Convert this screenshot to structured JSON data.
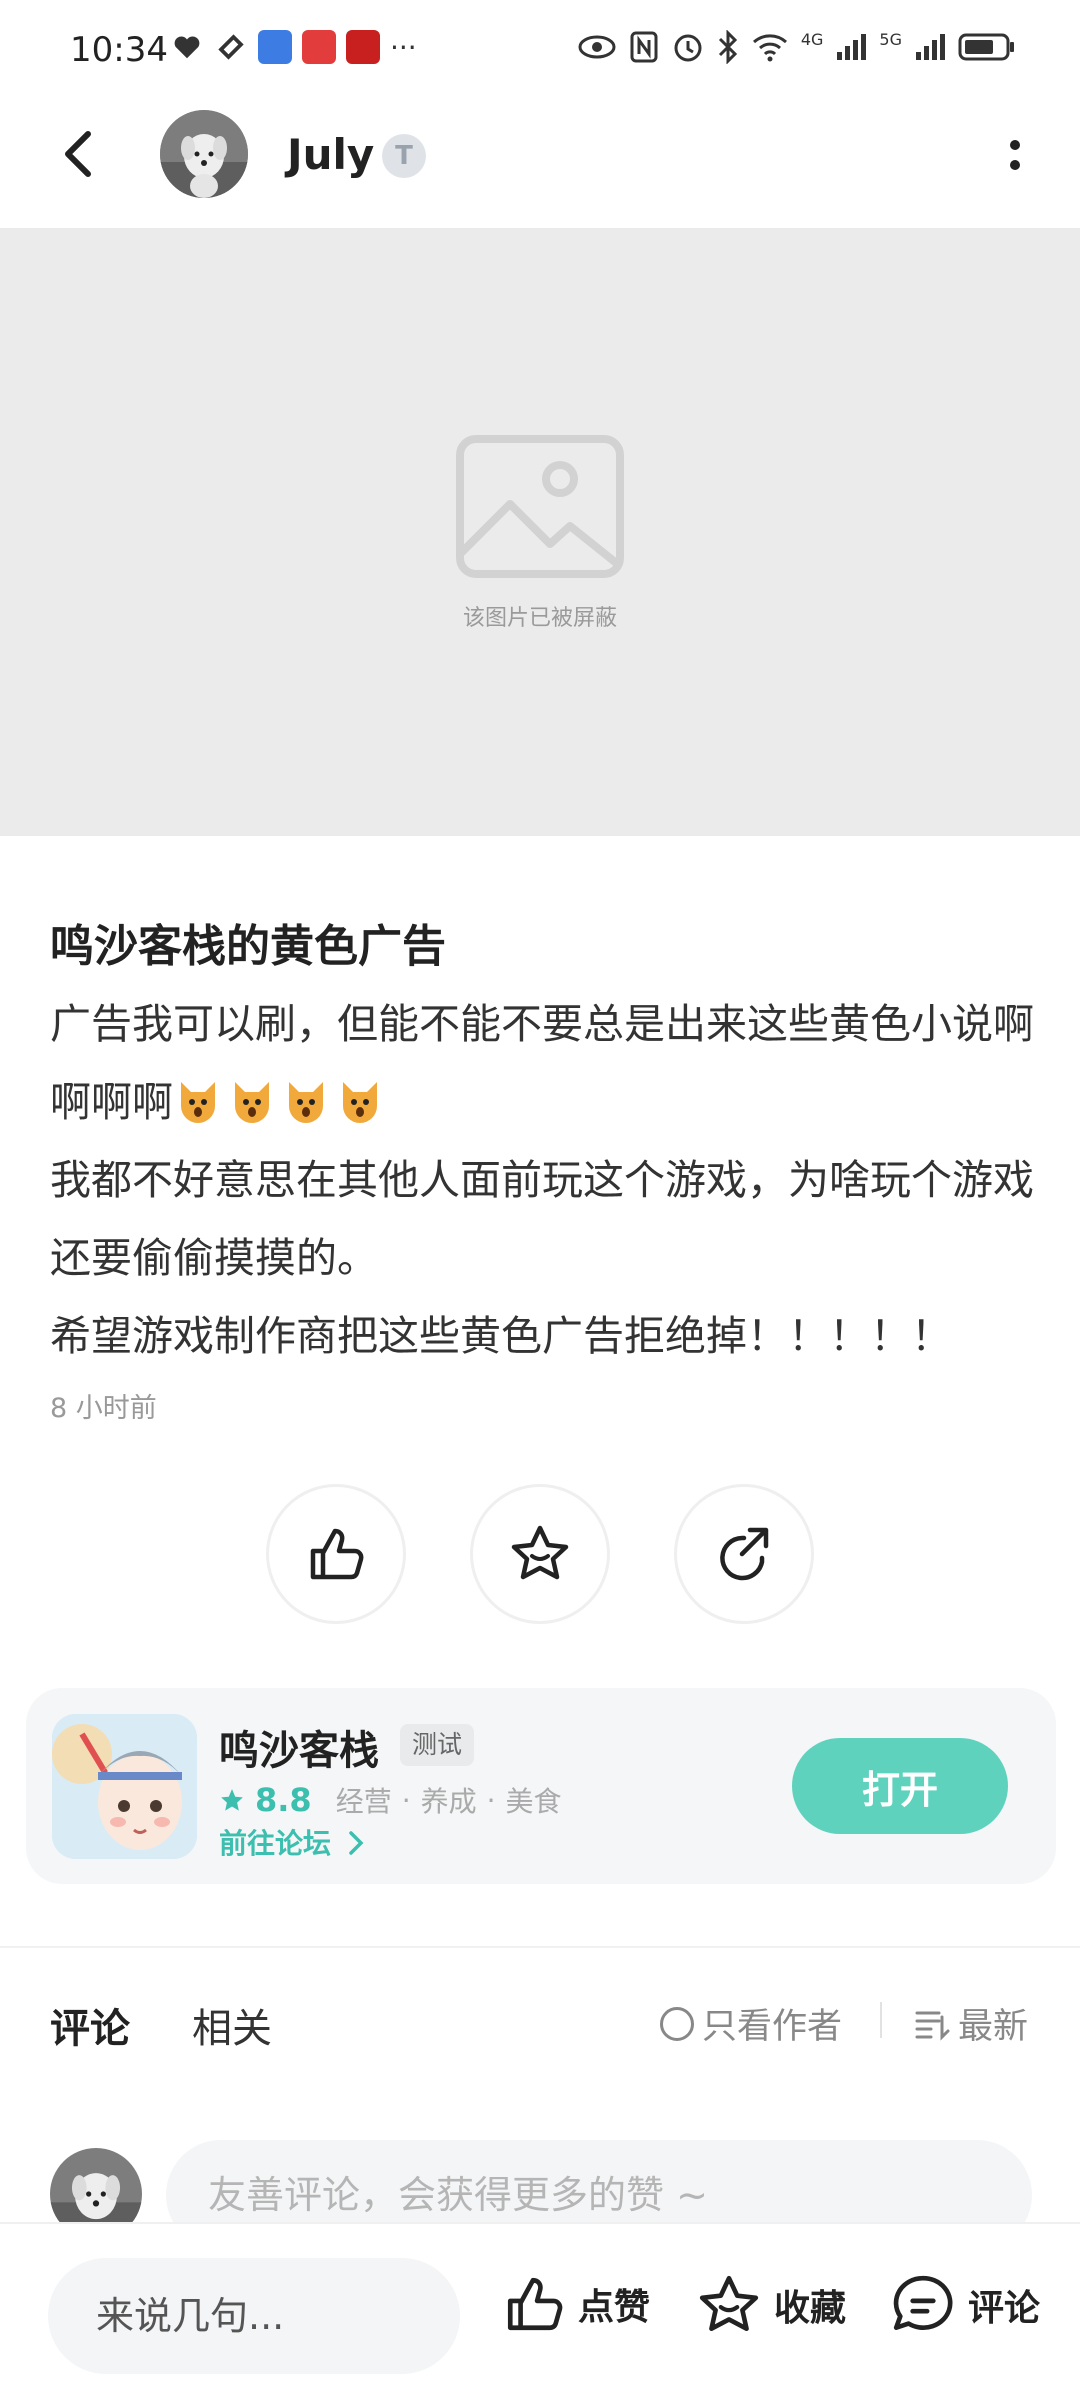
{
  "status_bar": {
    "time": "10:34",
    "more": "···",
    "network_1": "4G",
    "network_2": "5G"
  },
  "header": {
    "username": "July",
    "level": "T"
  },
  "image_placeholder": {
    "blocked_text": "该图片已被屏蔽"
  },
  "post": {
    "title": "鸣沙客栈的黄色广告",
    "line1": "广告我可以刷，但能不能不要总是出来这些黄色小说啊啊啊啊",
    "line2": "我都不好意思在其他人面前玩这个游戏，为啥玩个游戏还要偷偷摸摸的。",
    "line3": "希望游戏制作商把这些黄色广告拒绝掉！！！！！",
    "time": "8 小时前"
  },
  "actions": {
    "like_icon": "thumbs-up-icon",
    "favorite_icon": "star-icon",
    "share_icon": "share-icon"
  },
  "game_card": {
    "name": "鸣沙客栈",
    "tag": "测试",
    "rating": "8.8",
    "genres": [
      "经营",
      "养成",
      "美食"
    ],
    "forum_link": "前往论坛",
    "open_label": "打开",
    "accent_color": "#5fd2be"
  },
  "comments_section": {
    "tab_comments": "评论",
    "tab_related": "相关",
    "filter_author": "只看作者",
    "sort_label": "最新",
    "input_placeholder": "友善评论，会获得更多的赞 ~"
  },
  "bottom_bar": {
    "input_placeholder": "来说几句...",
    "like_label": "点赞",
    "favorite_label": "收藏",
    "comment_label": "评论"
  }
}
